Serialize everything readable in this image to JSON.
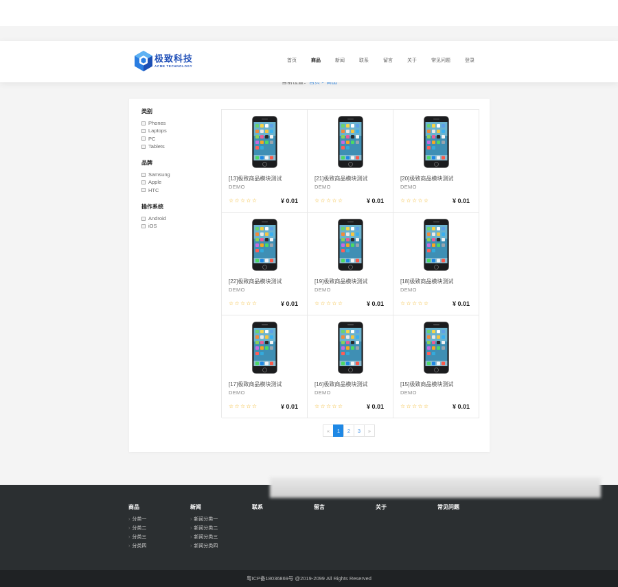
{
  "brand": {
    "name_cn": "极致科技",
    "name_en": "ACME TECHNOLOGY"
  },
  "nav": [
    {
      "label": "首页"
    },
    {
      "label": "商品"
    },
    {
      "label": "新闻"
    },
    {
      "label": "联系"
    },
    {
      "label": "留言"
    },
    {
      "label": "关于"
    },
    {
      "label": "常见问题"
    },
    {
      "label": "登录"
    }
  ],
  "breadcrumb": {
    "prefix": "当前位置：",
    "home": "首页",
    "sep": " > ",
    "current": "商品"
  },
  "filters": [
    {
      "title": "类别",
      "options": [
        "Phones",
        "Laptops",
        "PC",
        "Tablets"
      ]
    },
    {
      "title": "品牌",
      "options": [
        "Samsung",
        "Apple",
        "HTC"
      ]
    },
    {
      "title": "操作系统",
      "options": [
        "Android",
        "iOS"
      ]
    }
  ],
  "products": [
    {
      "name": "[13]极致商品模块测试",
      "category": "DEMO",
      "price": "¥ 0.01",
      "stars": "☆☆☆☆☆"
    },
    {
      "name": "[21]极致商品模块测试",
      "category": "DEMO",
      "price": "¥ 0.01",
      "stars": "☆☆☆☆☆"
    },
    {
      "name": "[20]极致商品模块测试",
      "category": "DEMO",
      "price": "¥ 0.01",
      "stars": "☆☆☆☆☆"
    },
    {
      "name": "[22]极致商品模块测试",
      "category": "DEMO",
      "price": "¥ 0.01",
      "stars": "☆☆☆☆☆"
    },
    {
      "name": "[19]极致商品模块测试",
      "category": "DEMO",
      "price": "¥ 0.01",
      "stars": "☆☆☆☆☆"
    },
    {
      "name": "[18]极致商品模块测试",
      "category": "DEMO",
      "price": "¥ 0.01",
      "stars": "☆☆☆☆☆"
    },
    {
      "name": "[17]极致商品模块测试",
      "category": "DEMO",
      "price": "¥ 0.01",
      "stars": "☆☆☆☆☆"
    },
    {
      "name": "[16]极致商品模块测试",
      "category": "DEMO",
      "price": "¥ 0.01",
      "stars": "☆☆☆☆☆"
    },
    {
      "name": "[15]极致商品模块测试",
      "category": "DEMO",
      "price": "¥ 0.01",
      "stars": "☆☆☆☆☆"
    }
  ],
  "pagination": {
    "prev": "«",
    "pages": [
      "1",
      "2",
      "3"
    ],
    "current": "1",
    "next": "»"
  },
  "footer": {
    "columns": [
      {
        "title": "商品",
        "links": [
          "分类一",
          "分类二",
          "分类三",
          "分类四"
        ]
      },
      {
        "title": "新闻",
        "links": [
          "新闻分类一",
          "新闻分类二",
          "新闻分类三",
          "新闻分类四"
        ]
      },
      {
        "title": "联系",
        "links": []
      },
      {
        "title": "留言",
        "links": []
      },
      {
        "title": "关于",
        "links": []
      },
      {
        "title": "常见问题",
        "links": []
      }
    ],
    "copyright": "粤ICP备18036869号 @2019-2099 All Rights Reserved"
  },
  "colors": {
    "accent": "#1e88e5",
    "brand": "#1f4fb8",
    "star": "#f0b21a",
    "footer_bg": "#2b2f31"
  }
}
